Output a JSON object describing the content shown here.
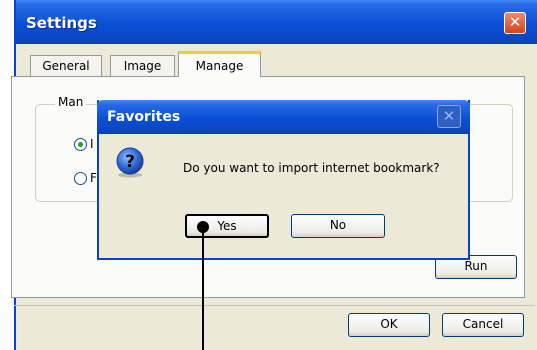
{
  "settings": {
    "title": "Settings",
    "close_glyph": "✕",
    "tabs": [
      {
        "label": "General"
      },
      {
        "label": "Image"
      },
      {
        "label": "Manage"
      }
    ],
    "manage": {
      "group_label": "Man",
      "radio1_label": "I",
      "radio2_label": "F",
      "run_label": "Run"
    },
    "ok_label": "OK",
    "cancel_label": "Cancel"
  },
  "dialog": {
    "title": "Favorites",
    "close_glyph": "✕",
    "message": "Do you want to import internet bookmark?",
    "icon": "question-icon",
    "yes_label": "Yes",
    "no_label": "No"
  },
  "colors": {
    "titlebar": "#0A4FD5",
    "window_bg": "#ECE9D8",
    "tab_highlight": "#FFC73C"
  }
}
